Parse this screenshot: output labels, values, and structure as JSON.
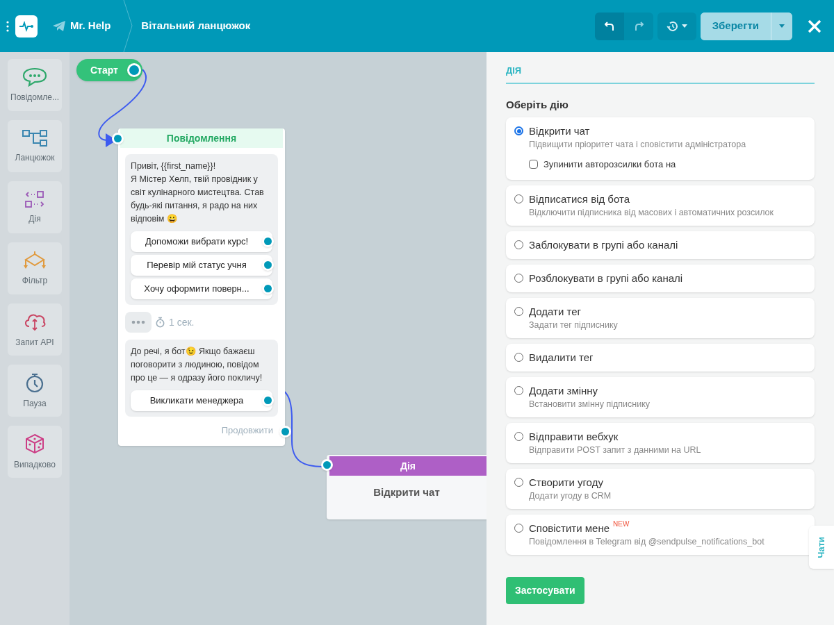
{
  "header": {
    "bot_name": "Mr. Help",
    "chain_title": "Вітальний ланцюжок",
    "save_label": "Зберегти"
  },
  "palette": {
    "items": [
      {
        "kind": "message",
        "label": "Повідомле..."
      },
      {
        "kind": "chain",
        "label": "Ланцюжок"
      },
      {
        "kind": "action",
        "label": "Дія"
      },
      {
        "kind": "filter",
        "label": "Фільтр"
      },
      {
        "kind": "api",
        "label": "Запит API"
      },
      {
        "kind": "pause",
        "label": "Пауза"
      },
      {
        "kind": "random",
        "label": "Випадково"
      }
    ]
  },
  "canvas": {
    "start_node": {
      "label": "Старт"
    },
    "message_node": {
      "title": "Повідомлення",
      "blocks": [
        {
          "kind": "text",
          "text": "Привіт, {{first_name}}!\nЯ Містер Хелп, твій провідник у світ кулінарного мистецтва. Став будь-які питання, я радо на них відповім 😀",
          "buttons": [
            "Допоможи вибрати курс!",
            "Перевір мій статус учня",
            "Хочу оформити поверн..."
          ]
        },
        {
          "kind": "typing",
          "text": "1 сек."
        },
        {
          "kind": "text",
          "text": "До речі, я бот😉 Якщо бажаєш поговорити з людиною, повідом про це — я одразу його покличу!",
          "buttons": [
            "Викликати менеджера"
          ]
        }
      ],
      "continue_label": "Продовжити"
    },
    "action_node": {
      "title": "Дія",
      "text": "Відкрити чат"
    }
  },
  "panel": {
    "tab": "ДІЯ",
    "heading": "Оберіть дію",
    "options": [
      {
        "label": "Відкрити чат",
        "description": "Підвищити пріоритет чата і сповістити адміністратора",
        "selected": true,
        "checkbox": {
          "label": "Зупинити авторозсилки бота на",
          "checked": false
        }
      },
      {
        "label": "Відписатися від бота",
        "description": "Відключити підписника від масових і автоматичних розсилок",
        "selected": false
      },
      {
        "label": "Заблокувати в групі або каналі",
        "selected": false
      },
      {
        "label": "Розблокувати в групі або каналі",
        "selected": false
      },
      {
        "label": "Додати тег",
        "description": "Задати тег підписнику",
        "selected": false
      },
      {
        "label": "Видалити тег",
        "selected": false
      },
      {
        "label": "Додати змінну",
        "description": "Встановити змінну підписнику",
        "selected": false
      },
      {
        "label": "Відправити вебхук",
        "description": "Відправити POST запит з данними на URL",
        "selected": false
      },
      {
        "label": "Створити угоду",
        "description": "Додати угоду в CRM",
        "selected": false
      },
      {
        "label": "Сповістити мене",
        "badge": "NEW",
        "description": "Повідомлення в Telegram від @sendpulse_notifications_bot",
        "selected": false
      }
    ],
    "apply_label": "Застосувати"
  },
  "side_tab": "Чати"
}
